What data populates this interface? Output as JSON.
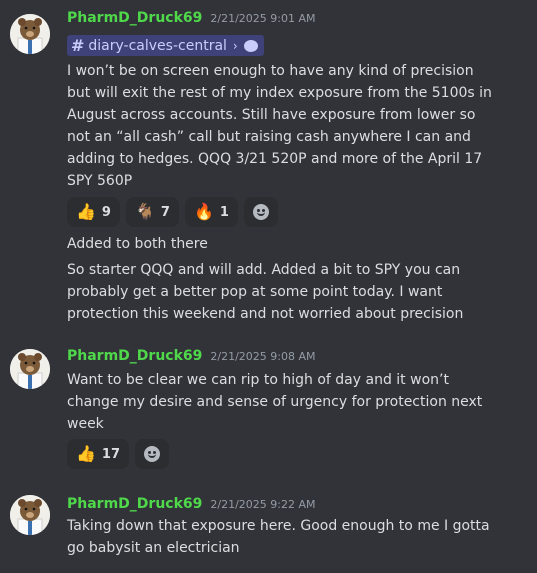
{
  "messages": [
    {
      "username": "PharmD_Druck69",
      "timestamp": "2/21/2025 9:01 AM",
      "channel": "diary-calves-central",
      "lines": [
        "I won’t be on screen enough to have any kind of precision",
        "but will exit the rest of my index exposure from the 5100s in",
        "August across accounts. Still have exposure from lower so",
        "not an “all cash” call but raising cash anywhere I can and",
        "adding to hedges. QQQ 3/21 520P and more of the April 17",
        "SPY 560P"
      ],
      "reactions": [
        {
          "emoji": "👍",
          "count": "9"
        },
        {
          "emoji": "🐐",
          "count": "7"
        },
        {
          "emoji": "🔥",
          "count": "1"
        }
      ],
      "followups": [
        "Added to both there",
        "So starter QQQ and will add. Added a bit to SPY you can",
        "probably get a better pop at some point today. I want",
        "protection this weekend and not worried about precision"
      ]
    },
    {
      "username": "PharmD_Druck69",
      "timestamp": "2/21/2025 9:08 AM",
      "lines": [
        "Want to be clear we can rip to high of day and it won’t",
        "change my desire and sense of urgency for protection next",
        "week"
      ],
      "reactions": [
        {
          "emoji": "👍",
          "count": "17"
        }
      ]
    },
    {
      "username": "PharmD_Druck69",
      "timestamp": "2/21/2025 9:22 AM",
      "lines": [
        "Taking down that exposure here. Good enough to me I gotta",
        "go babysit an electrician"
      ]
    }
  ],
  "colors": {
    "background": "#323339",
    "username": "#4fd94a",
    "text": "#dbdee1",
    "timestamp": "#949ba4",
    "channel_pill": "#3f4278"
  },
  "icons": [
    "avatar-bear-doctor",
    "hash-icon",
    "chevron-right-icon",
    "thread-bubble-icon",
    "add-reaction-icon"
  ]
}
